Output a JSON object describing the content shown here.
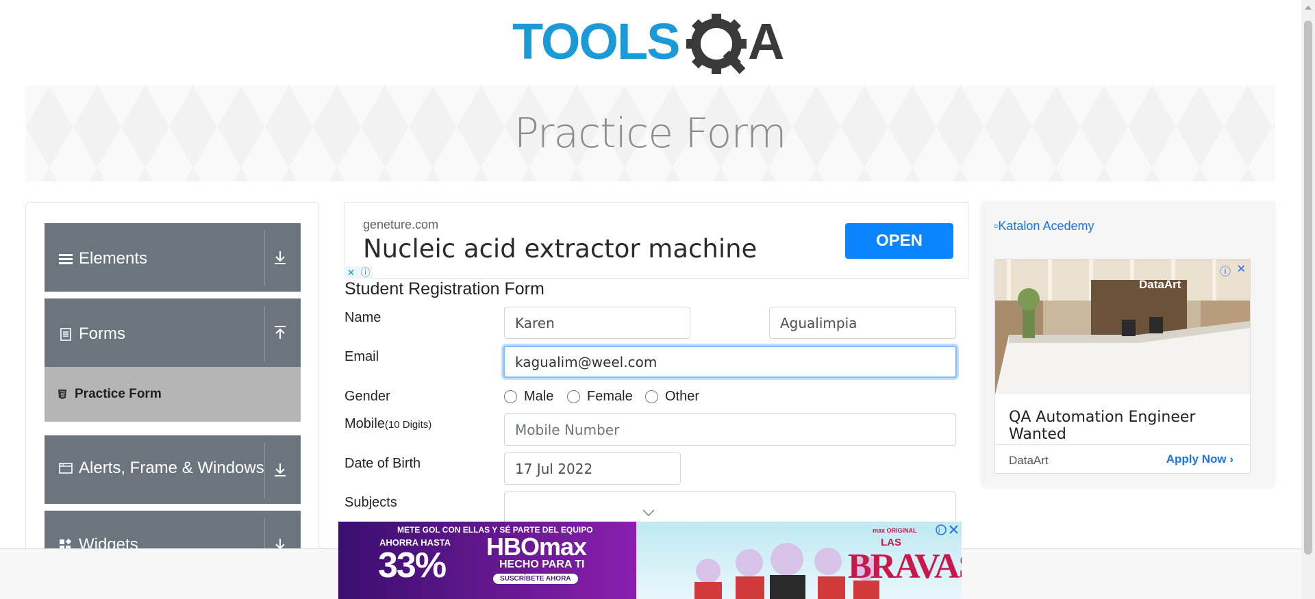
{
  "page": {
    "title": "Practice Form"
  },
  "sidebar": {
    "groups": [
      {
        "label": "Elements"
      },
      {
        "label": "Forms"
      },
      {
        "label": "Alerts, Frame & Windows"
      },
      {
        "label": "Widgets"
      }
    ],
    "active_item": "Practice Form"
  },
  "ad_top": {
    "domain": "geneture.com",
    "headline": "Nucleic acid extractor machine",
    "button": "OPEN"
  },
  "form": {
    "title": "Student Registration Form",
    "name_label": "Name",
    "first_name": "Karen",
    "last_name": "Agualimpia",
    "email_label": "Email",
    "email": "kagualim@weel.com",
    "gender_label": "Gender",
    "genders": [
      "Male",
      "Female",
      "Other"
    ],
    "mobile_label": "Mobile",
    "mobile_hint": "(10 Digits)",
    "mobile_placeholder": "Mobile Number",
    "dob_label": "Date of Birth",
    "dob": "17 Jul 2022",
    "subjects_label": "Subjects"
  },
  "ad_right": {
    "broken_image_alt": "Katalon Acedemy",
    "card_title": "QA Automation Engineer Wanted",
    "advertiser": "DataArt",
    "cta": "Apply Now"
  },
  "ad_bottom": {
    "promo_line": "METE GOL CON ELLAS Y SÉ PARTE DEL EQUIPO",
    "save_label": "AHORRA HASTA",
    "discount": "33%",
    "brand": "HBOmax",
    "tagline": "HECHO PARA TI",
    "subscribe": "SUSCRÍBETE AHORA",
    "show_title_1": "LAS",
    "show_title_2": "BRAVAS",
    "show_badge": "max ORIGINAL"
  },
  "colors": {
    "brand_blue": "#1a9ad6",
    "sidebar": "#6c757d",
    "cta": "#0a84ff"
  }
}
